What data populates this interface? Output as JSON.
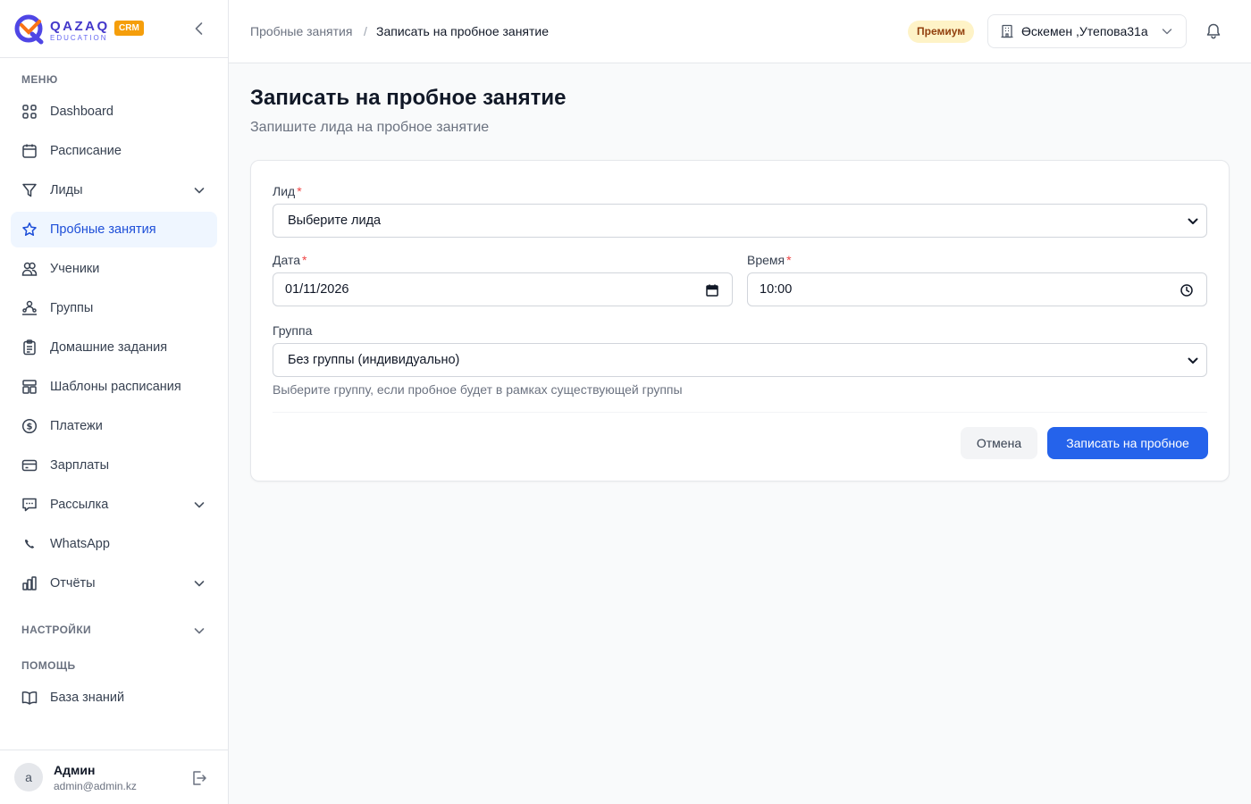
{
  "brand": {
    "name": "QAZAQ",
    "sub": "EDUCATION",
    "badge": "CRM"
  },
  "sidebar": {
    "menu_label": "МЕНЮ",
    "items": [
      {
        "label": "Dashboard",
        "icon": "grid-icon"
      },
      {
        "label": "Расписание",
        "icon": "calendar-icon"
      },
      {
        "label": "Лиды",
        "icon": "funnel-icon",
        "expandable": true
      },
      {
        "label": "Пробные занятия",
        "icon": "star-icon",
        "active": true
      },
      {
        "label": "Ученики",
        "icon": "users-icon"
      },
      {
        "label": "Группы",
        "icon": "group-icon"
      },
      {
        "label": "Домашние задания",
        "icon": "clipboard-icon"
      },
      {
        "label": "Шаблоны расписания",
        "icon": "template-icon"
      },
      {
        "label": "Платежи",
        "icon": "dollar-icon"
      },
      {
        "label": "Зарплаты",
        "icon": "card-icon"
      },
      {
        "label": "Рассылка",
        "icon": "message-icon",
        "expandable": true
      },
      {
        "label": "WhatsApp",
        "icon": "phone-icon"
      },
      {
        "label": "Отчёты",
        "icon": "bar-chart-icon",
        "expandable": true
      }
    ],
    "settings_label": "НАСТРОЙКИ",
    "help_label": "ПОМОЩЬ",
    "help_items": [
      {
        "label": "База знаний",
        "icon": "book-icon"
      }
    ],
    "user": {
      "initial": "a",
      "name": "Админ",
      "email": "admin@admin.kz"
    }
  },
  "header": {
    "breadcrumb": [
      "Пробные занятия",
      "Записать на пробное занятие"
    ],
    "separator": "/",
    "plan_badge": "Премиум",
    "branch": "Өскемен ,Утепова31а"
  },
  "page": {
    "title": "Записать на пробное занятие",
    "subtitle": "Запишите лида на пробное занятие"
  },
  "form": {
    "lead": {
      "label": "Лид",
      "required_mark": "*",
      "value": "Выберите лида"
    },
    "date": {
      "label": "Дата",
      "required_mark": "*",
      "value": "01/11/2026"
    },
    "time": {
      "label": "Время",
      "required_mark": "*",
      "value": "10:00"
    },
    "group": {
      "label": "Группа",
      "value": "Без группы (индивидуально)",
      "hint": "Выберите группу, если пробное будет в рамках существующей группы"
    },
    "cancel_label": "Отмена",
    "submit_label": "Записать на пробное"
  },
  "colors": {
    "accent": "#2563eb",
    "active_bg": "#eff6ff",
    "required": "#ef4444",
    "premium_bg": "#fef3c7",
    "premium_text": "#92400e",
    "crm_badge": "#f59e0b"
  }
}
